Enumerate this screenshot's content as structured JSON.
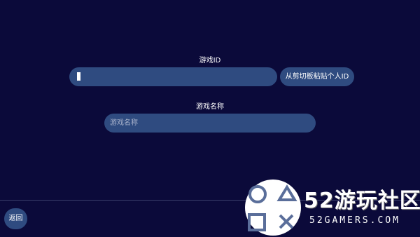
{
  "form": {
    "game_id_label": "游戏ID",
    "game_id_value": "",
    "paste_button_label": "从剪切板粘贴个人ID",
    "game_name_label": "游戏名称",
    "game_name_placeholder": "游戏名称"
  },
  "footer": {
    "back_label": "返回"
  },
  "watermark": {
    "title": "52游玩社区",
    "subtitle": "52GAMERS.COM"
  },
  "colors": {
    "background": "#0b0a3a",
    "field": "#2f4b80",
    "text": "#ffffff"
  }
}
